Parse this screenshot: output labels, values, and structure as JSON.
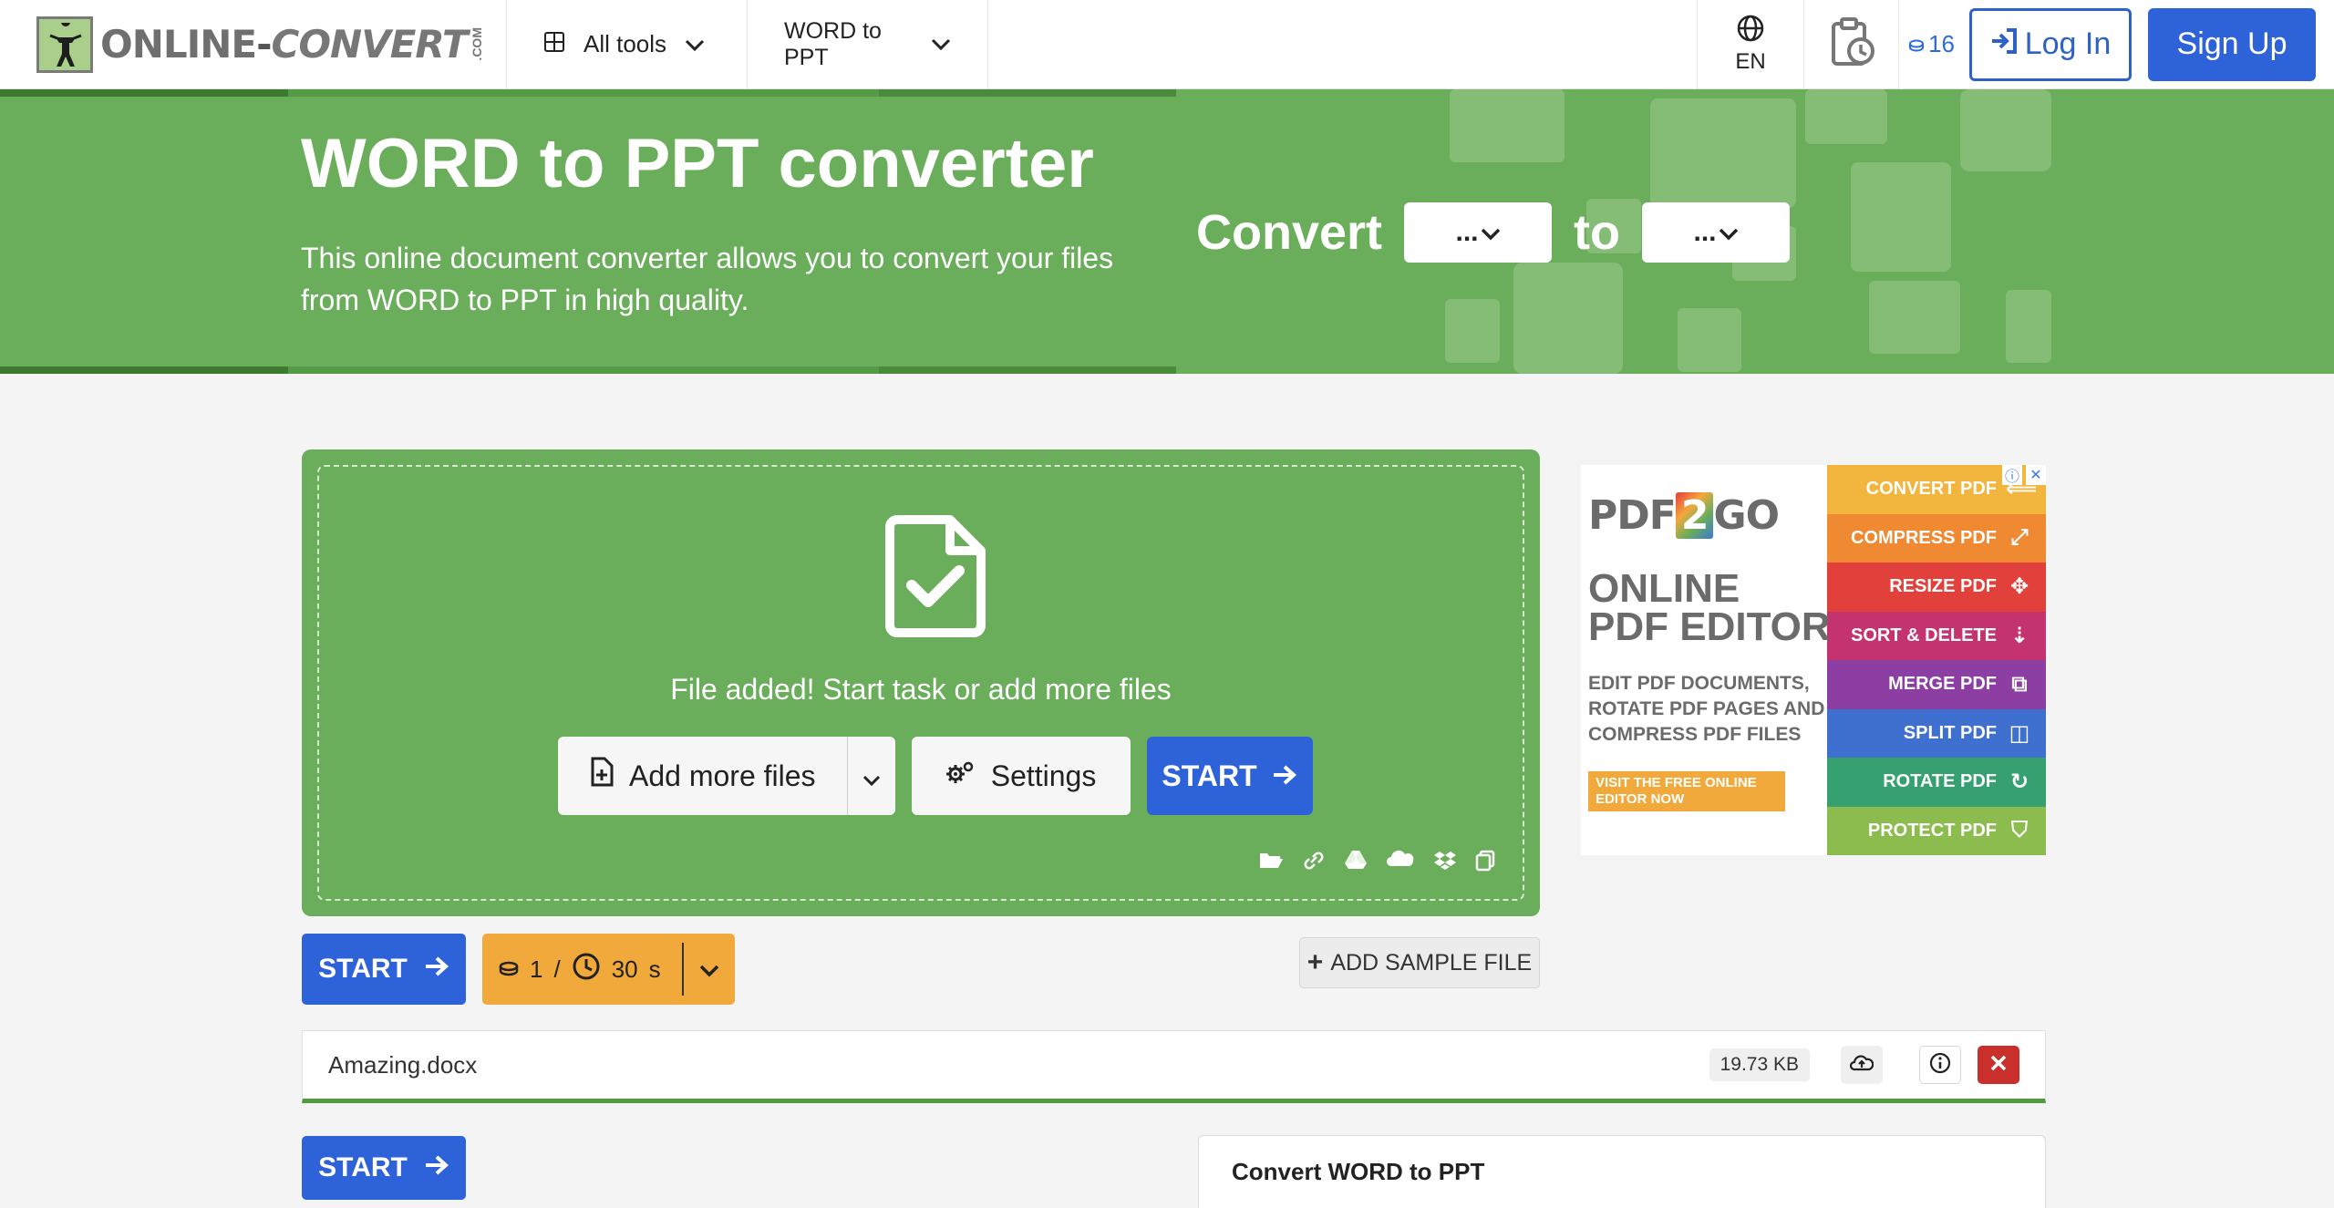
{
  "brand": {
    "name_part1": "ONLINE",
    "name_dash": "-",
    "name_part2": "CONVERT",
    "com": ".COM"
  },
  "nav": {
    "all_tools": "All tools",
    "converter": "WORD to PPT",
    "language": "EN",
    "credits": "16",
    "login": "Log In",
    "signup": "Sign Up"
  },
  "hero": {
    "title": "WORD to PPT converter",
    "description": "This online document converter allows you to convert your files from WORD to PPT in high quality.",
    "convert_label": "Convert",
    "from_value": "...",
    "to_label": "to",
    "to_value": "..."
  },
  "upload": {
    "status": "File added! Start task or add more files",
    "add_more": "Add more files",
    "settings": "Settings",
    "start": "START"
  },
  "actions": {
    "start": "START",
    "credit_cost": "1",
    "separator": "/",
    "time_value": "30",
    "time_unit": "s",
    "add_sample": "ADD SAMPLE FILE"
  },
  "file": {
    "name": "Amazing.docx",
    "size": "19.73 KB"
  },
  "options": {
    "start": "START",
    "title": "Convert WORD to PPT"
  },
  "ad": {
    "logo_left": "PDF",
    "logo_mid": "2",
    "logo_right": "GO",
    "title_line1": "ONLINE",
    "title_line2": "PDF EDITOR",
    "subtitle": "EDIT PDF DOCUMENTS, ROTATE PDF PAGES AND COMPRESS PDF FILES",
    "cta": "VISIT THE FREE ONLINE EDITOR NOW",
    "bands": [
      {
        "label": "CONVERT PDF",
        "color": "#f2b53d"
      },
      {
        "label": "COMPRESS PDF",
        "color": "#ef8a33"
      },
      {
        "label": "RESIZE PDF",
        "color": "#e2403b"
      },
      {
        "label": "SORT & DELETE",
        "color": "#c5336f"
      },
      {
        "label": "MERGE PDF",
        "color": "#8c3ea3"
      },
      {
        "label": "SPLIT PDF",
        "color": "#3f6fcf"
      },
      {
        "label": "ROTATE PDF",
        "color": "#36a070"
      },
      {
        "label": "PROTECT PDF",
        "color": "#8cbc4e"
      }
    ]
  },
  "colors": {
    "brand_green": "#6aad5a",
    "primary_blue": "#2e62d8",
    "credit_orange": "#f2a93c",
    "delete_red": "#c9302c"
  }
}
